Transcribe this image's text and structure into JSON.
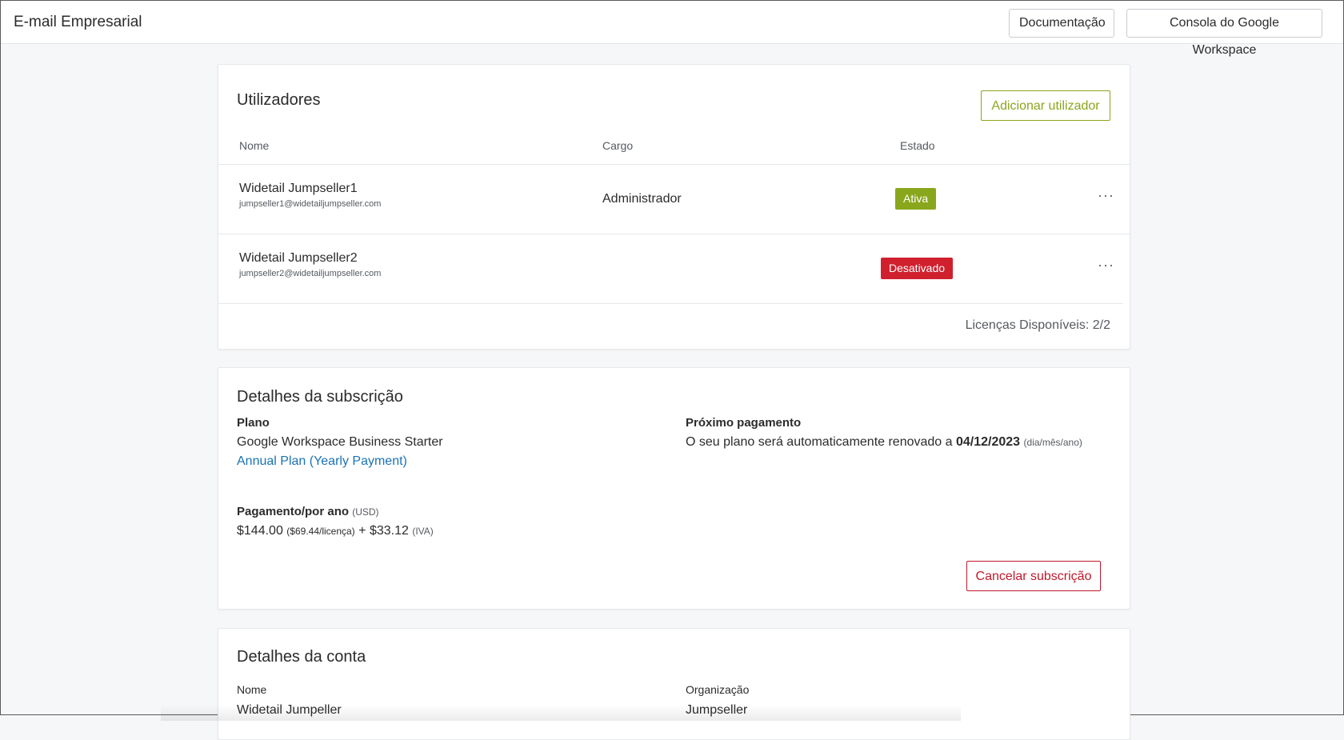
{
  "header": {
    "title": "E-mail Empresarial",
    "docs_label": "Documentação",
    "console_label": "Consola do Google Workspace"
  },
  "users": {
    "title": "Utilizadores",
    "add_label": "Adicionar utilizador",
    "columns": {
      "name": "Nome",
      "role": "Cargo",
      "status": "Estado"
    },
    "rows": [
      {
        "name": "Widetail Jumpseller1",
        "email": "jumpseller1@widetailjumpseller.com",
        "role": "Administrador",
        "status": "Ativa",
        "menu": "···"
      },
      {
        "name": "Widetail Jumpseller2",
        "email": "jumpseller2@widetailjumpseller.com",
        "role": "",
        "status": "Desativado",
        "menu": "···"
      }
    ],
    "licenses": "Licenças Disponíveis: 2/2"
  },
  "subscription": {
    "title": "Detalhes da subscrição",
    "plan_label": "Plano",
    "plan_name": "Google Workspace Business Starter",
    "plan_link": "Annual Plan (Yearly Payment)",
    "next_label": "Próximo pagamento",
    "next_text": "O seu plano será automaticamente renovado a",
    "next_date": "04/12/2023",
    "next_date_format": "(dia/mês/ano)",
    "payment_label": "Pagamento/por ano",
    "payment_currency": "(USD)",
    "payment_amount": "$144.00",
    "payment_per_license": "($69.44/licença)",
    "payment_plus": "+",
    "payment_tax": "$33.12",
    "payment_tax_label": "(IVA)",
    "cancel_label": "Cancelar subscrição"
  },
  "account": {
    "title": "Detalhes da conta",
    "name_label": "Nome",
    "name_value": "Widetail Jumpeller",
    "org_label": "Organização",
    "org_value": "Jumpseller"
  },
  "colors": {
    "accent_green": "#8aa61c",
    "danger_red": "#d0202e",
    "link_blue": "#1a73b5"
  }
}
